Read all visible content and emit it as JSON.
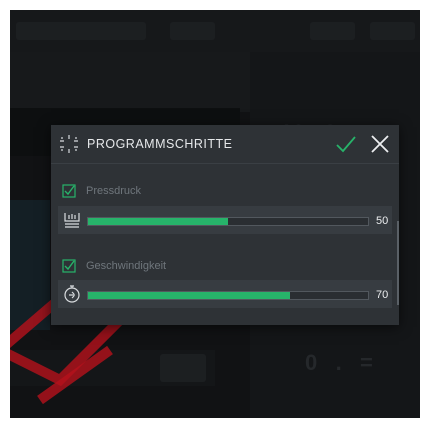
{
  "colors": {
    "accent": "#27b36a",
    "dialog_bg": "#2e3236",
    "row_bg": "#373c41"
  },
  "dialog": {
    "title": "PROGRAMMSCHRITTE",
    "header_icon": "program-steps-icon",
    "confirm_icon": "checkmark-icon",
    "close_icon": "close-icon"
  },
  "params": [
    {
      "label": "Pressdruck",
      "checked": true,
      "icon": "pressure-icon",
      "value": "50",
      "fill_fraction": 0.5
    },
    {
      "label": "Geschwindigkeit",
      "checked": true,
      "icon": "speed-icon",
      "value": "70",
      "fill_fraction": 0.72
    }
  ]
}
